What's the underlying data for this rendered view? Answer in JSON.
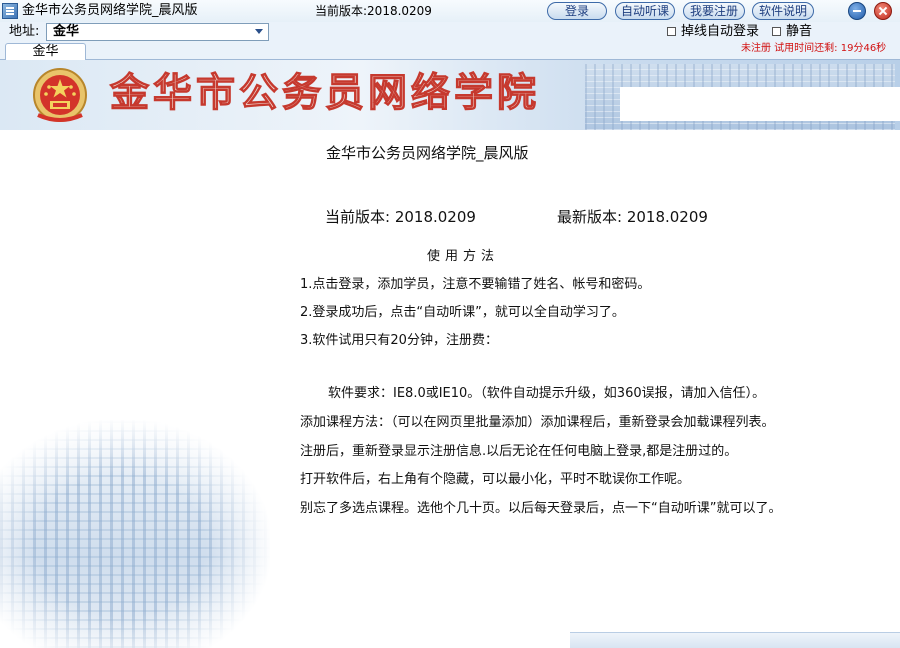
{
  "window": {
    "title": "金华市公务员网络学院_晨风版",
    "version_label": "当前版本:2018.0209"
  },
  "toolbar": {
    "login": "登录",
    "auto_listen": "自动听课",
    "register": "我要注册",
    "manual": "软件说明"
  },
  "address": {
    "label": "地址:",
    "selected": "金华"
  },
  "options": {
    "auto_relogin": "掉线自动登录",
    "mute": "静音"
  },
  "trial_text": "未注册  试用时间还剩: 19分46秒",
  "tab": {
    "label": "金华"
  },
  "banner": {
    "title": "金华市公务员网络学院"
  },
  "content": {
    "headline": "金华市公务员网络学院_晨风版",
    "current_version": "当前版本: 2018.0209",
    "latest_version": "最新版本: 2018.0209",
    "usage_title": "使用方法",
    "lines": [
      "1.点击登录，添加学员，注意不要输错了姓名、帐号和密码。",
      "2.登录成功后，点击“自动听课”，就可以全自动学习了。",
      "3.软件试用只有20分钟，注册费：",
      "软件要求：IE8.0或IE10。（软件自动提示升级，如360误报，请加入信任）。",
      "添加课程方法：（可以在网页里批量添加）添加课程后，重新登录会加载课程列表。",
      "注册后，重新登录显示注册信息.以后无论在任何电脑上登录,都是注册过的。",
      "打开软件后，右上角有个隐藏，可以最小化，平时不耽误你工作呢。",
      "别忘了多选点课程。选他个几十页。以后每天登录后，点一下“自动听课”就可以了。"
    ]
  },
  "colors": {
    "accent_blue": "#1f3f80",
    "trial_red": "#d21212",
    "banner_red": "#c6392e"
  },
  "icons": {
    "app": "app-icon",
    "minimize": "minimize-icon",
    "close": "close-icon",
    "dropdown": "chevron-down-icon",
    "emblem": "national-emblem-icon"
  }
}
